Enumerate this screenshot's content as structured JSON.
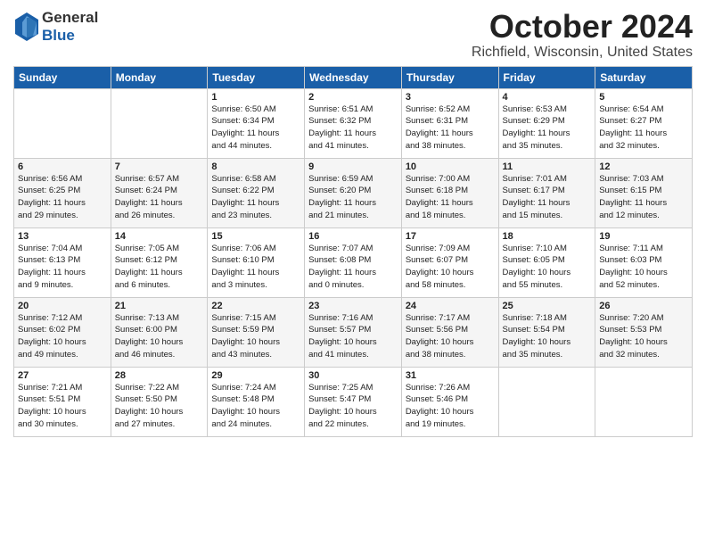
{
  "header": {
    "logo_general": "General",
    "logo_blue": "Blue",
    "month": "October 2024",
    "location": "Richfield, Wisconsin, United States"
  },
  "weekdays": [
    "Sunday",
    "Monday",
    "Tuesday",
    "Wednesday",
    "Thursday",
    "Friday",
    "Saturday"
  ],
  "weeks": [
    [
      {
        "day": "",
        "info": ""
      },
      {
        "day": "",
        "info": ""
      },
      {
        "day": "1",
        "info": "Sunrise: 6:50 AM\nSunset: 6:34 PM\nDaylight: 11 hours\nand 44 minutes."
      },
      {
        "day": "2",
        "info": "Sunrise: 6:51 AM\nSunset: 6:32 PM\nDaylight: 11 hours\nand 41 minutes."
      },
      {
        "day": "3",
        "info": "Sunrise: 6:52 AM\nSunset: 6:31 PM\nDaylight: 11 hours\nand 38 minutes."
      },
      {
        "day": "4",
        "info": "Sunrise: 6:53 AM\nSunset: 6:29 PM\nDaylight: 11 hours\nand 35 minutes."
      },
      {
        "day": "5",
        "info": "Sunrise: 6:54 AM\nSunset: 6:27 PM\nDaylight: 11 hours\nand 32 minutes."
      }
    ],
    [
      {
        "day": "6",
        "info": "Sunrise: 6:56 AM\nSunset: 6:25 PM\nDaylight: 11 hours\nand 29 minutes."
      },
      {
        "day": "7",
        "info": "Sunrise: 6:57 AM\nSunset: 6:24 PM\nDaylight: 11 hours\nand 26 minutes."
      },
      {
        "day": "8",
        "info": "Sunrise: 6:58 AM\nSunset: 6:22 PM\nDaylight: 11 hours\nand 23 minutes."
      },
      {
        "day": "9",
        "info": "Sunrise: 6:59 AM\nSunset: 6:20 PM\nDaylight: 11 hours\nand 21 minutes."
      },
      {
        "day": "10",
        "info": "Sunrise: 7:00 AM\nSunset: 6:18 PM\nDaylight: 11 hours\nand 18 minutes."
      },
      {
        "day": "11",
        "info": "Sunrise: 7:01 AM\nSunset: 6:17 PM\nDaylight: 11 hours\nand 15 minutes."
      },
      {
        "day": "12",
        "info": "Sunrise: 7:03 AM\nSunset: 6:15 PM\nDaylight: 11 hours\nand 12 minutes."
      }
    ],
    [
      {
        "day": "13",
        "info": "Sunrise: 7:04 AM\nSunset: 6:13 PM\nDaylight: 11 hours\nand 9 minutes."
      },
      {
        "day": "14",
        "info": "Sunrise: 7:05 AM\nSunset: 6:12 PM\nDaylight: 11 hours\nand 6 minutes."
      },
      {
        "day": "15",
        "info": "Sunrise: 7:06 AM\nSunset: 6:10 PM\nDaylight: 11 hours\nand 3 minutes."
      },
      {
        "day": "16",
        "info": "Sunrise: 7:07 AM\nSunset: 6:08 PM\nDaylight: 11 hours\nand 0 minutes."
      },
      {
        "day": "17",
        "info": "Sunrise: 7:09 AM\nSunset: 6:07 PM\nDaylight: 10 hours\nand 58 minutes."
      },
      {
        "day": "18",
        "info": "Sunrise: 7:10 AM\nSunset: 6:05 PM\nDaylight: 10 hours\nand 55 minutes."
      },
      {
        "day": "19",
        "info": "Sunrise: 7:11 AM\nSunset: 6:03 PM\nDaylight: 10 hours\nand 52 minutes."
      }
    ],
    [
      {
        "day": "20",
        "info": "Sunrise: 7:12 AM\nSunset: 6:02 PM\nDaylight: 10 hours\nand 49 minutes."
      },
      {
        "day": "21",
        "info": "Sunrise: 7:13 AM\nSunset: 6:00 PM\nDaylight: 10 hours\nand 46 minutes."
      },
      {
        "day": "22",
        "info": "Sunrise: 7:15 AM\nSunset: 5:59 PM\nDaylight: 10 hours\nand 43 minutes."
      },
      {
        "day": "23",
        "info": "Sunrise: 7:16 AM\nSunset: 5:57 PM\nDaylight: 10 hours\nand 41 minutes."
      },
      {
        "day": "24",
        "info": "Sunrise: 7:17 AM\nSunset: 5:56 PM\nDaylight: 10 hours\nand 38 minutes."
      },
      {
        "day": "25",
        "info": "Sunrise: 7:18 AM\nSunset: 5:54 PM\nDaylight: 10 hours\nand 35 minutes."
      },
      {
        "day": "26",
        "info": "Sunrise: 7:20 AM\nSunset: 5:53 PM\nDaylight: 10 hours\nand 32 minutes."
      }
    ],
    [
      {
        "day": "27",
        "info": "Sunrise: 7:21 AM\nSunset: 5:51 PM\nDaylight: 10 hours\nand 30 minutes."
      },
      {
        "day": "28",
        "info": "Sunrise: 7:22 AM\nSunset: 5:50 PM\nDaylight: 10 hours\nand 27 minutes."
      },
      {
        "day": "29",
        "info": "Sunrise: 7:24 AM\nSunset: 5:48 PM\nDaylight: 10 hours\nand 24 minutes."
      },
      {
        "day": "30",
        "info": "Sunrise: 7:25 AM\nSunset: 5:47 PM\nDaylight: 10 hours\nand 22 minutes."
      },
      {
        "day": "31",
        "info": "Sunrise: 7:26 AM\nSunset: 5:46 PM\nDaylight: 10 hours\nand 19 minutes."
      },
      {
        "day": "",
        "info": ""
      },
      {
        "day": "",
        "info": ""
      }
    ]
  ]
}
